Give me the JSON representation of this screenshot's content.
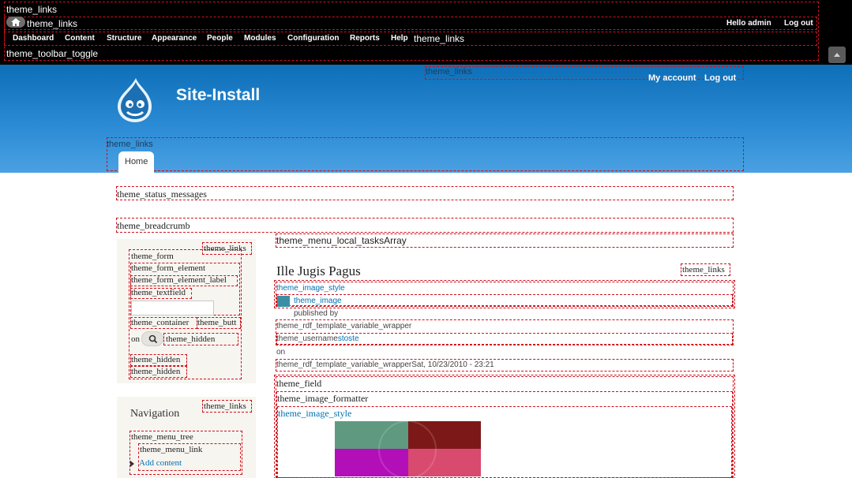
{
  "toolbar": {
    "theme_links_top": "theme_links",
    "theme_links_home": "theme_links",
    "hello_prefix": "Hello ",
    "username": "admin",
    "logout": "Log out",
    "menu": [
      "Dashboard",
      "Content",
      "Structure",
      "Appearance",
      "People",
      "Modules",
      "Configuration",
      "Reports",
      "Help"
    ],
    "theme_links_menu": "theme_links",
    "toggle_label": "theme_toolbar_toggle"
  },
  "header": {
    "theme_links_secondary": "theme_links",
    "my_account": "My account",
    "logout": "Log out",
    "site_name": "Site-Install",
    "theme_links_primary": "theme_links",
    "home_tab": "Home"
  },
  "regions": {
    "status_messages": "theme_status_messages",
    "breadcrumb": "theme_breadcrumb",
    "local_tasks": "theme_menu_local_tasksArray"
  },
  "sidebar": {
    "search_block": {
      "theme_links": "theme_links",
      "form": "theme_form",
      "form_element": "theme_form_element",
      "form_element_label": "theme_form_element_label",
      "textfield": "theme_textfield",
      "container": "theme_container",
      "button": "theme_butt",
      "on": "on",
      "hidden1": "theme_hidden",
      "hidden2": "theme_hidden",
      "hidden3": "theme_hidden"
    },
    "navigation_block": {
      "theme_links": "theme_links",
      "title": "Navigation",
      "menu_tree": "theme_menu_tree",
      "menu_link": "theme_menu_link",
      "add_content": "Add content"
    }
  },
  "node": {
    "title": "Ille Jugis Pagus",
    "theme_links": "theme_links",
    "image_style": "theme_image_style",
    "image": "theme_image",
    "published_by": "published by",
    "rdf_wrapper_1": "theme_rdf_template_variable_wrapper",
    "username_prefix": "theme_username",
    "username": "stoste",
    "on": "on",
    "rdf_wrapper_2": "theme_rdf_template_variable_wrapper",
    "date": "Sat, 10/23/2010 - 23:21",
    "field": "theme_field",
    "image_formatter": "theme_image_formatter",
    "image_style_2": "theme_image_style"
  },
  "colors": {
    "debug_border": "#d0101c",
    "link": "#0071b3",
    "header_top": "#0d6fb7",
    "header_bottom": "#4aa1e2",
    "tile_green": "#5f9a80",
    "tile_darkred": "#7d1818",
    "tile_magenta": "#b30fb8",
    "tile_pink": "#d84a6e"
  }
}
